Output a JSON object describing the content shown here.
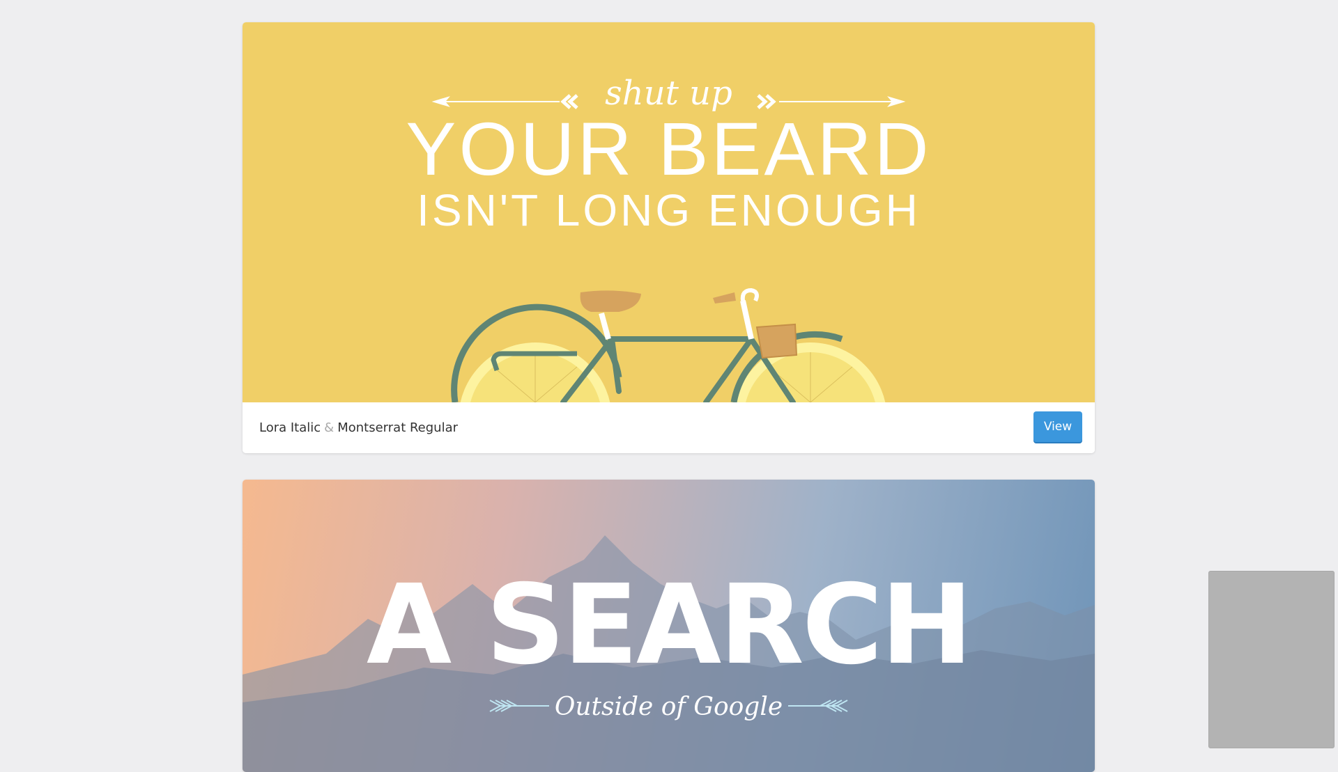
{
  "cards": [
    {
      "poster": {
        "small_line": "shut up",
        "big_line": "YOUR BEARD",
        "mid_line": "ISN'T LONG ENOUGH",
        "background": "#f0cf67"
      },
      "footer": {
        "font_a": "Lora Italic",
        "separator": "&",
        "font_b": "Montserrat Regular",
        "button_label": "View"
      }
    },
    {
      "poster": {
        "big_line": "A SEARCH",
        "small_line": "Outside of Google"
      }
    }
  ],
  "colors": {
    "button": "#3b97dd",
    "page_bg": "#eeeef0",
    "bike_frame": "#5f8574",
    "wheel": "#fdf3a0",
    "saddle": "#d6a35e"
  },
  "icons": {
    "bike": "bicycle-illustration",
    "arrows": "decorative-arrows",
    "laurels": "decorative-laurels"
  }
}
